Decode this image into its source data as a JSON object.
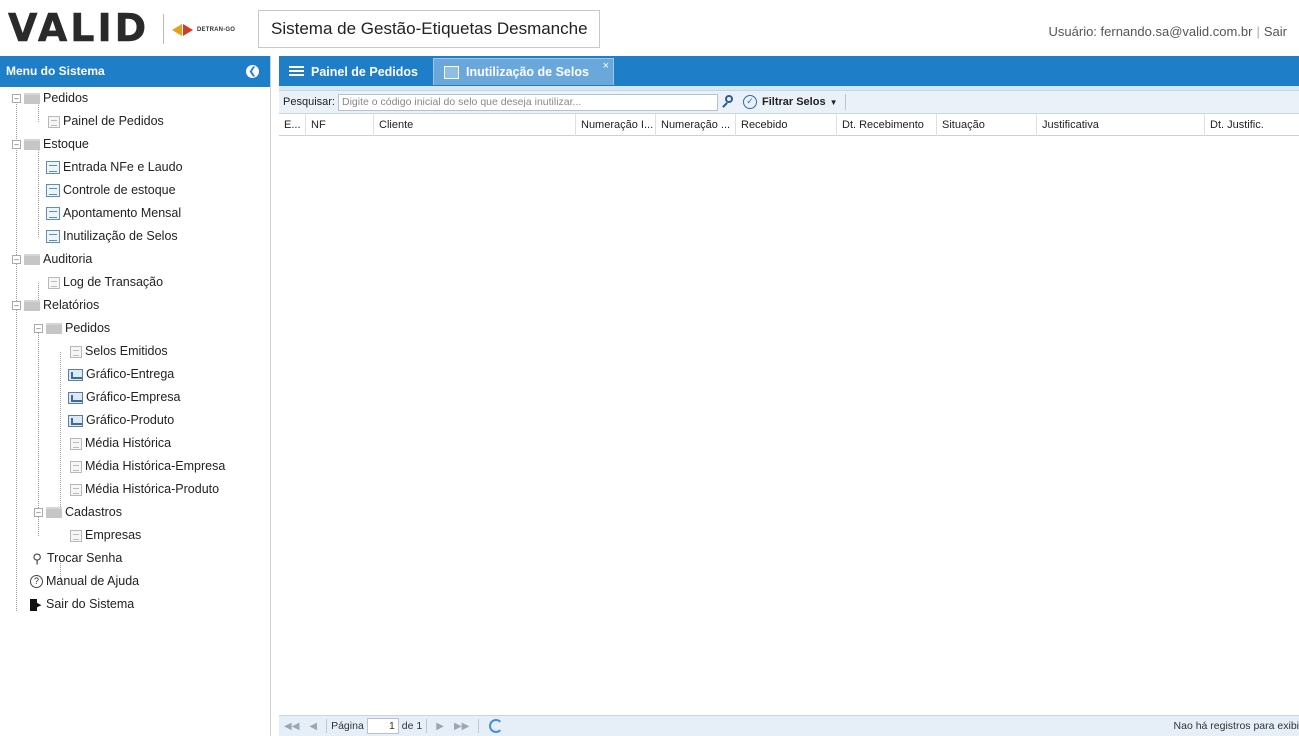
{
  "header": {
    "logo_text": "VALID",
    "partner_logo_text": "DETRAN-GO",
    "app_title": "Sistema de Gestão-Etiquetas Desmanche",
    "user_label": "Usuário: fernando.sa@valid.com.br",
    "logout_label": "Sair"
  },
  "sidebar": {
    "title": "Menu do Sistema",
    "collapse_icon": "chevron-left-icon",
    "tree": {
      "pedidos": "Pedidos",
      "painel_pedidos": "Painel de Pedidos",
      "estoque": "Estoque",
      "entrada_nfe": "Entrada NFe e Laudo",
      "controle_estoque": "Controle de estoque",
      "apontamento": "Apontamento Mensal",
      "inutilizacao": "Inutilização de Selos",
      "auditoria": "Auditoria",
      "log_transacao": "Log de Transação",
      "relatorios": "Relatórios",
      "rel_pedidos": "Pedidos",
      "selos_emitidos": "Selos Emitidos",
      "graf_entrega": "Gráfico-Entrega",
      "graf_empresa": "Gráfico-Empresa",
      "graf_produto": "Gráfico-Produto",
      "media_hist": "Média Histórica",
      "media_hist_empresa": "Média Histórica-Empresa",
      "media_hist_produto": "Média Histórica-Produto",
      "cadastros": "Cadastros",
      "empresas": "Empresas",
      "trocar_senha": "Trocar Senha",
      "manual_ajuda": "Manual de Ajuda",
      "sair_sistema": "Sair do Sistema"
    }
  },
  "tabs": [
    {
      "label": "Painel de Pedidos",
      "active": false
    },
    {
      "label": "Inutilização de Selos",
      "active": true
    }
  ],
  "toolbar": {
    "search_label": "Pesquisar:",
    "search_placeholder": "Digite o código inicial do selo que deseja inutilizar...",
    "search_value": "",
    "filter_label": "Filtrar Selos"
  },
  "grid": {
    "columns": [
      "E...",
      "NF",
      "Cliente",
      "Numeração I...",
      "Numeração ...",
      "Recebido",
      "Dt. Recebimento",
      "Situação",
      "Justificativa",
      "Dt. Justific."
    ],
    "rows": []
  },
  "pager": {
    "page_label": "Página",
    "page_value": "1",
    "of_label": "de 1",
    "empty_message": "Nao há registros para exibi"
  },
  "colors": {
    "accent": "#1e7ec8",
    "active_tab": "#6aa8dc",
    "toolbar_bg": "#eaf1f8"
  }
}
